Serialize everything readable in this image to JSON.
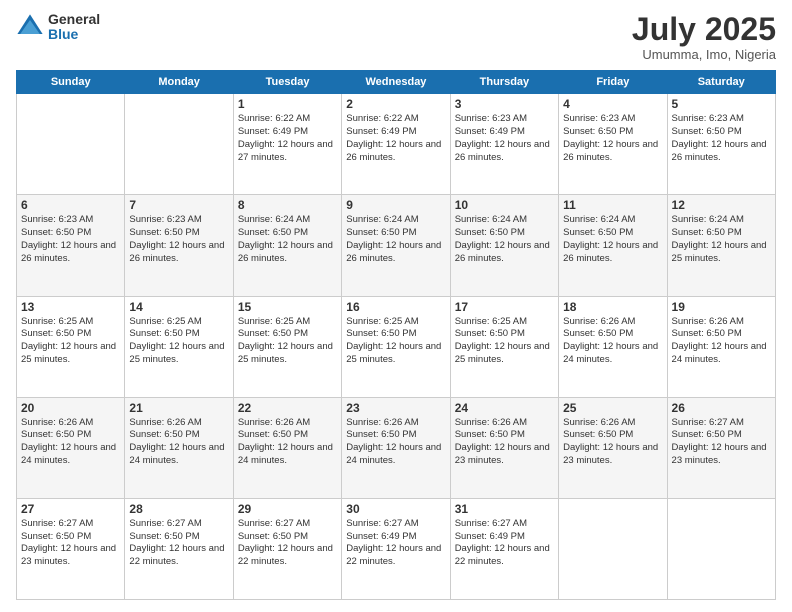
{
  "logo": {
    "general": "General",
    "blue": "Blue"
  },
  "title": {
    "month_year": "July 2025",
    "location": "Umumma, Imo, Nigeria"
  },
  "weekdays": [
    "Sunday",
    "Monday",
    "Tuesday",
    "Wednesday",
    "Thursday",
    "Friday",
    "Saturday"
  ],
  "weeks": [
    [
      {
        "day": "",
        "info": ""
      },
      {
        "day": "",
        "info": ""
      },
      {
        "day": "1",
        "info": "Sunrise: 6:22 AM\nSunset: 6:49 PM\nDaylight: 12 hours and 27 minutes."
      },
      {
        "day": "2",
        "info": "Sunrise: 6:22 AM\nSunset: 6:49 PM\nDaylight: 12 hours and 26 minutes."
      },
      {
        "day": "3",
        "info": "Sunrise: 6:23 AM\nSunset: 6:49 PM\nDaylight: 12 hours and 26 minutes."
      },
      {
        "day": "4",
        "info": "Sunrise: 6:23 AM\nSunset: 6:50 PM\nDaylight: 12 hours and 26 minutes."
      },
      {
        "day": "5",
        "info": "Sunrise: 6:23 AM\nSunset: 6:50 PM\nDaylight: 12 hours and 26 minutes."
      }
    ],
    [
      {
        "day": "6",
        "info": "Sunrise: 6:23 AM\nSunset: 6:50 PM\nDaylight: 12 hours and 26 minutes."
      },
      {
        "day": "7",
        "info": "Sunrise: 6:23 AM\nSunset: 6:50 PM\nDaylight: 12 hours and 26 minutes."
      },
      {
        "day": "8",
        "info": "Sunrise: 6:24 AM\nSunset: 6:50 PM\nDaylight: 12 hours and 26 minutes."
      },
      {
        "day": "9",
        "info": "Sunrise: 6:24 AM\nSunset: 6:50 PM\nDaylight: 12 hours and 26 minutes."
      },
      {
        "day": "10",
        "info": "Sunrise: 6:24 AM\nSunset: 6:50 PM\nDaylight: 12 hours and 26 minutes."
      },
      {
        "day": "11",
        "info": "Sunrise: 6:24 AM\nSunset: 6:50 PM\nDaylight: 12 hours and 26 minutes."
      },
      {
        "day": "12",
        "info": "Sunrise: 6:24 AM\nSunset: 6:50 PM\nDaylight: 12 hours and 25 minutes."
      }
    ],
    [
      {
        "day": "13",
        "info": "Sunrise: 6:25 AM\nSunset: 6:50 PM\nDaylight: 12 hours and 25 minutes."
      },
      {
        "day": "14",
        "info": "Sunrise: 6:25 AM\nSunset: 6:50 PM\nDaylight: 12 hours and 25 minutes."
      },
      {
        "day": "15",
        "info": "Sunrise: 6:25 AM\nSunset: 6:50 PM\nDaylight: 12 hours and 25 minutes."
      },
      {
        "day": "16",
        "info": "Sunrise: 6:25 AM\nSunset: 6:50 PM\nDaylight: 12 hours and 25 minutes."
      },
      {
        "day": "17",
        "info": "Sunrise: 6:25 AM\nSunset: 6:50 PM\nDaylight: 12 hours and 25 minutes."
      },
      {
        "day": "18",
        "info": "Sunrise: 6:26 AM\nSunset: 6:50 PM\nDaylight: 12 hours and 24 minutes."
      },
      {
        "day": "19",
        "info": "Sunrise: 6:26 AM\nSunset: 6:50 PM\nDaylight: 12 hours and 24 minutes."
      }
    ],
    [
      {
        "day": "20",
        "info": "Sunrise: 6:26 AM\nSunset: 6:50 PM\nDaylight: 12 hours and 24 minutes."
      },
      {
        "day": "21",
        "info": "Sunrise: 6:26 AM\nSunset: 6:50 PM\nDaylight: 12 hours and 24 minutes."
      },
      {
        "day": "22",
        "info": "Sunrise: 6:26 AM\nSunset: 6:50 PM\nDaylight: 12 hours and 24 minutes."
      },
      {
        "day": "23",
        "info": "Sunrise: 6:26 AM\nSunset: 6:50 PM\nDaylight: 12 hours and 24 minutes."
      },
      {
        "day": "24",
        "info": "Sunrise: 6:26 AM\nSunset: 6:50 PM\nDaylight: 12 hours and 23 minutes."
      },
      {
        "day": "25",
        "info": "Sunrise: 6:26 AM\nSunset: 6:50 PM\nDaylight: 12 hours and 23 minutes."
      },
      {
        "day": "26",
        "info": "Sunrise: 6:27 AM\nSunset: 6:50 PM\nDaylight: 12 hours and 23 minutes."
      }
    ],
    [
      {
        "day": "27",
        "info": "Sunrise: 6:27 AM\nSunset: 6:50 PM\nDaylight: 12 hours and 23 minutes."
      },
      {
        "day": "28",
        "info": "Sunrise: 6:27 AM\nSunset: 6:50 PM\nDaylight: 12 hours and 22 minutes."
      },
      {
        "day": "29",
        "info": "Sunrise: 6:27 AM\nSunset: 6:50 PM\nDaylight: 12 hours and 22 minutes."
      },
      {
        "day": "30",
        "info": "Sunrise: 6:27 AM\nSunset: 6:49 PM\nDaylight: 12 hours and 22 minutes."
      },
      {
        "day": "31",
        "info": "Sunrise: 6:27 AM\nSunset: 6:49 PM\nDaylight: 12 hours and 22 minutes."
      },
      {
        "day": "",
        "info": ""
      },
      {
        "day": "",
        "info": ""
      }
    ]
  ]
}
